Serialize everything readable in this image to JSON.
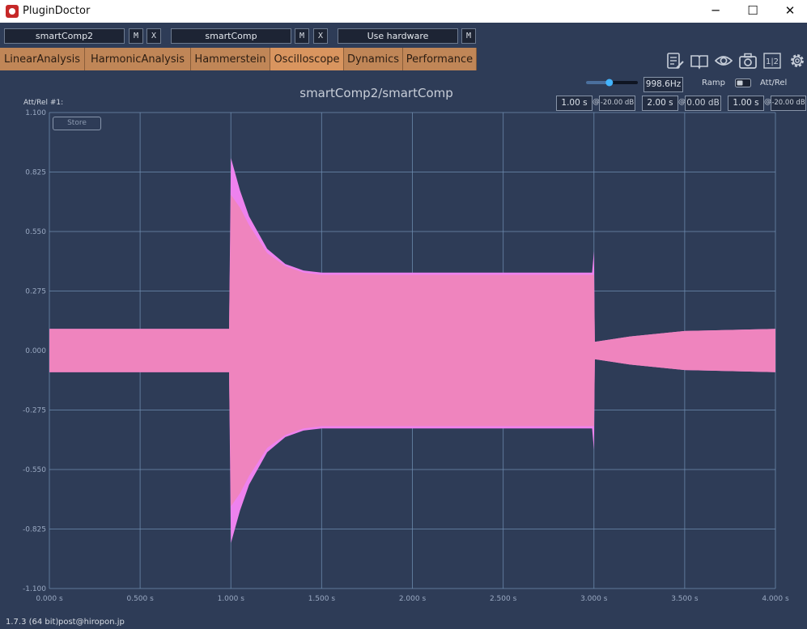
{
  "window": {
    "title": "PluginDoctor",
    "minimize": "─",
    "maximize": "☐",
    "close": "✕"
  },
  "toolbar": {
    "plugin_a": "smartComp2",
    "plugin_b": "smartComp",
    "hardware": "Use hardware",
    "m_label": "M",
    "x_label": "X"
  },
  "tabs": [
    {
      "label": "LinearAnalysis"
    },
    {
      "label": "HarmonicAnalysis"
    },
    {
      "label": "Hammerstein"
    },
    {
      "label": "Oscilloscope"
    },
    {
      "label": "Dynamics"
    },
    {
      "label": "Performance"
    }
  ],
  "tool_icons": [
    "notes-icon",
    "book-icon",
    "eye-icon",
    "camera-icon",
    "split-view-icon",
    "gear-icon"
  ],
  "tool_icon_texts": {
    "split": "1|2"
  },
  "controls": {
    "frequency": "998.6Hz",
    "frequency_slider": 0.45,
    "ramp_label": "Ramp",
    "attrel_label": "Att/Rel",
    "attrel_toggle_on": false,
    "segments": [
      {
        "time": "1.00 s",
        "level": "-20.00 dB"
      },
      {
        "time": "2.00 s",
        "level": "0.00 dB"
      },
      {
        "time": "1.00 s",
        "level": "-20.00 dB"
      }
    ],
    "at_symbol": "@"
  },
  "plot": {
    "title": "smartComp2/smartComp",
    "attrel_info": "Att/Rel #1:",
    "store": "Store"
  },
  "chart_data": {
    "type": "area",
    "title": "smartComp2/smartComp",
    "xlim": [
      0,
      4
    ],
    "ylim": [
      -1.1,
      1.1
    ],
    "x_ticks": [
      "0.000 s",
      "0.500 s",
      "1.000 s",
      "1.500 s",
      "2.000 s",
      "2.500 s",
      "3.000 s",
      "3.500 s",
      "4.000 s"
    ],
    "y_ticks": [
      "1.100",
      "0.825",
      "0.550",
      "0.275",
      "0.000",
      "-0.275",
      "-0.550",
      "-0.825",
      "-1.100"
    ],
    "x_tick_values": [
      0,
      0.5,
      1,
      1.5,
      2,
      2.5,
      3,
      3.5,
      4
    ],
    "y_tick_values": [
      1.1,
      0.825,
      0.55,
      0.275,
      0,
      -0.275,
      -0.55,
      -0.825,
      -1.1
    ],
    "grid": true,
    "series": [
      {
        "color": "#ee82ee",
        "envelope": [
          [
            0,
            0.1
          ],
          [
            0.99,
            0.1
          ],
          [
            1.0,
            0.89
          ],
          [
            1.05,
            0.74
          ],
          [
            1.1,
            0.62
          ],
          [
            1.2,
            0.47
          ],
          [
            1.3,
            0.4
          ],
          [
            1.4,
            0.37
          ],
          [
            1.5,
            0.36
          ],
          [
            2.0,
            0.36
          ],
          [
            2.99,
            0.36
          ],
          [
            3.0,
            0.46
          ],
          [
            3.005,
            0.04
          ],
          [
            3.2,
            0.065
          ],
          [
            3.5,
            0.09
          ],
          [
            4.0,
            0.1
          ]
        ]
      },
      {
        "color": "#ef84be",
        "envelope": [
          [
            0,
            0.1
          ],
          [
            0.99,
            0.1
          ],
          [
            1.0,
            0.72
          ],
          [
            1.05,
            0.66
          ],
          [
            1.1,
            0.58
          ],
          [
            1.2,
            0.45
          ],
          [
            1.3,
            0.39
          ],
          [
            1.4,
            0.36
          ],
          [
            1.5,
            0.35
          ],
          [
            2.0,
            0.35
          ],
          [
            2.99,
            0.35
          ],
          [
            3.0,
            0.35
          ],
          [
            3.005,
            0.04
          ],
          [
            3.2,
            0.065
          ],
          [
            3.5,
            0.09
          ],
          [
            4.0,
            0.1
          ]
        ]
      }
    ]
  },
  "colors": {
    "background": "#2e3c57",
    "grid": "#6f8eb0",
    "tab": "#c08657"
  },
  "footer": {
    "version": "1.7.3 (64 bit)",
    "email": "post@hiropon.jp"
  }
}
